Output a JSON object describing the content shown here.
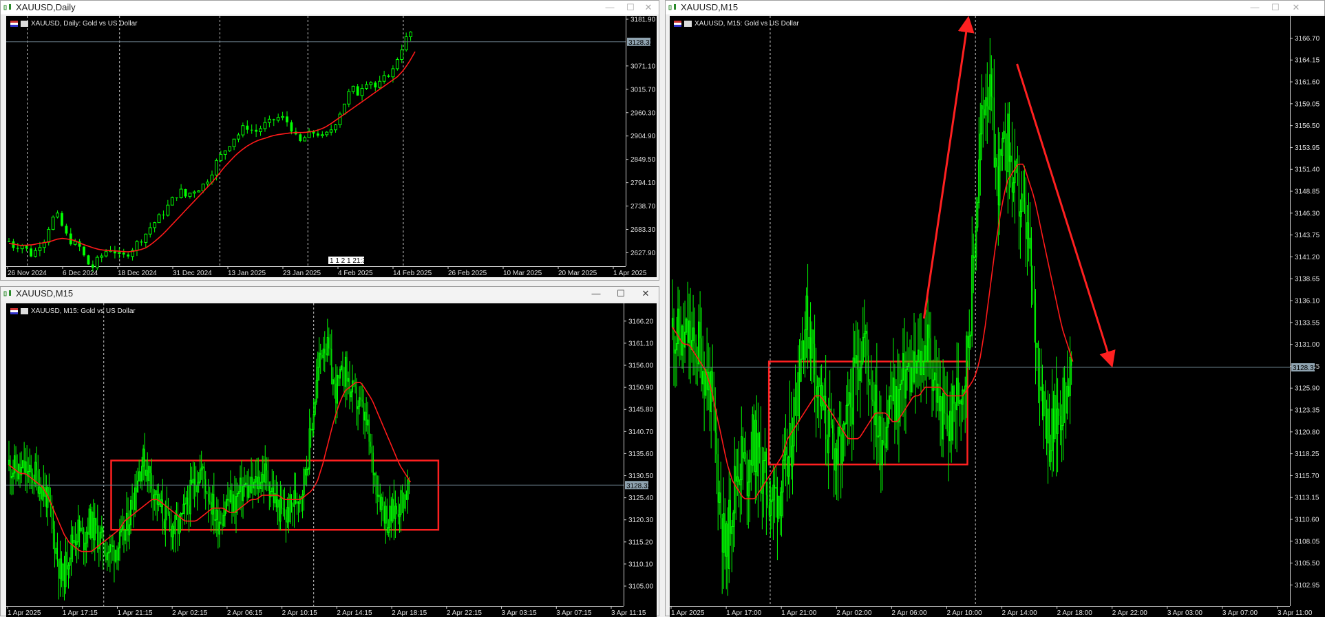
{
  "windows": {
    "daily": {
      "title": "XAUUSD,Daily",
      "legend": "XAUUSD, Daily:  Gold vs US Dollar",
      "controls": {
        "minimize": "—",
        "maximize": "☐",
        "close": "✕"
      }
    },
    "m15_small": {
      "title": "XAUUSD,M15",
      "legend": "XAUUSD, M15:  Gold vs US Dollar",
      "controls": {
        "minimize": "—",
        "maximize": "☐",
        "close": "✕"
      }
    },
    "m15_large": {
      "title": "XAUUSD,M15",
      "legend": "XAUUSD, M15:  Gold vs US Dollar",
      "controls": {
        "minimize": "—",
        "maximize": "☐",
        "close": "✕"
      }
    }
  },
  "colors": {
    "background": "#000000",
    "bull": "#00ff00",
    "bear": "#00ff00",
    "ma": "#ff1a1a",
    "annotation": "#ff2020",
    "grid_vertical": "#c8c8c8",
    "price_line": "#6a7f8c",
    "price_tag": "#8fa3b0"
  },
  "chart_data": [
    {
      "id": "daily",
      "type": "candlestick",
      "title": "XAUUSD, Daily:  Gold vs US Dollar",
      "current_price": "3128.32",
      "y_ticks": [
        "3181.90",
        "3071.10",
        "3015.70",
        "2960.30",
        "2904.90",
        "2849.50",
        "2794.10",
        "2738.70",
        "2683.30",
        "2627.90"
      ],
      "ylim": [
        2596,
        3190
      ],
      "x_ticks": [
        "26 Nov 2024",
        "6 Dec 2024",
        "18 Dec 2024",
        "31 Dec 2024",
        "13 Jan 2025",
        "23 Jan 2025",
        "4 Feb 2025",
        "14 Feb 2025",
        "26 Feb 2025",
        "10 Mar 2025",
        "20 Mar 2025",
        "1 Apr 2025"
      ],
      "period_marker": "1 1 2 1 21:30",
      "close_path": [
        2655,
        2640,
        2650,
        2635,
        2620,
        2645,
        2660,
        2700,
        2720,
        2690,
        2660,
        2650,
        2640,
        2610,
        2590,
        2610,
        2625,
        2640,
        2630,
        2615,
        2625,
        2640,
        2655,
        2670,
        2690,
        2705,
        2720,
        2740,
        2760,
        2775,
        2760,
        2775,
        2780,
        2790,
        2810,
        2840,
        2860,
        2880,
        2900,
        2910,
        2930,
        2920,
        2915,
        2930,
        2935,
        2945,
        2950,
        2940,
        2920,
        2885,
        2900,
        2910,
        2915,
        2900,
        2910,
        2930,
        2960,
        2990,
        3020,
        3005,
        3030,
        3040,
        3020,
        3030,
        3050,
        3060,
        3100,
        3130,
        3150
      ],
      "ma_path": [
        2650,
        2648,
        2645,
        2646,
        2647,
        2650,
        2652,
        2655,
        2660,
        2662,
        2660,
        2657,
        2650,
        2645,
        2640,
        2636,
        2634,
        2633,
        2632,
        2631,
        2630,
        2632,
        2635,
        2640,
        2650,
        2662,
        2675,
        2690,
        2705,
        2720,
        2735,
        2750,
        2765,
        2780,
        2795,
        2812,
        2830,
        2845,
        2860,
        2872,
        2882,
        2890,
        2896,
        2900,
        2905,
        2908,
        2910,
        2912,
        2913,
        2913,
        2914,
        2916,
        2920,
        2926,
        2935,
        2945,
        2955,
        2965,
        2975,
        2985,
        2995,
        3005,
        3015,
        3025,
        3035,
        3045,
        3060,
        3080,
        3105
      ]
    },
    {
      "id": "m15_small",
      "type": "candlestick",
      "title": "XAUUSD, M15:  Gold vs US Dollar",
      "current_price": "3128.32",
      "y_ticks": [
        "3166.20",
        "3161.10",
        "3156.00",
        "3150.90",
        "3145.80",
        "3140.70",
        "3135.60",
        "3130.50",
        "3125.40",
        "3120.30",
        "3115.20",
        "3110.10",
        "3105.00"
      ],
      "ylim": [
        3100.4,
        3170.3
      ],
      "x_ticks": [
        "1 Apr 2025",
        "1 Apr 17:15",
        "1 Apr 21:15",
        "2 Apr 02:15",
        "2 Apr 06:15",
        "2 Apr 10:15",
        "2 Apr 14:15",
        "2 Apr 18:15",
        "2 Apr 22:15",
        "3 Apr 03:15",
        "3 Apr 07:15",
        "3 Apr 11:15"
      ],
      "consolidation_box": {
        "low": 3118,
        "high": 3134
      },
      "close_path": [
        3133,
        3132,
        3131,
        3132,
        3130,
        3131,
        3128,
        3126,
        3120,
        3112,
        3106,
        3112,
        3116,
        3118,
        3116,
        3120,
        3118,
        3116,
        3114,
        3113,
        3114,
        3115,
        3118,
        3124,
        3130,
        3134,
        3132,
        3128,
        3124,
        3121,
        3120,
        3118,
        3119,
        3122,
        3126,
        3130,
        3132,
        3128,
        3124,
        3120,
        3122,
        3125,
        3124,
        3126,
        3128,
        3127,
        3128,
        3130,
        3131,
        3128,
        3124,
        3122,
        3121,
        3124,
        3126,
        3128,
        3135,
        3145,
        3156,
        3162,
        3158,
        3150,
        3152,
        3155,
        3150,
        3148,
        3146,
        3142,
        3134,
        3128,
        3124,
        3120,
        3122,
        3124,
        3126,
        3128
      ],
      "ma_path": [
        3133,
        3132,
        3131,
        3131,
        3130,
        3129,
        3128,
        3126,
        3123,
        3120,
        3117,
        3115,
        3114,
        3113,
        3113,
        3113,
        3114,
        3115,
        3116,
        3117,
        3118,
        3120,
        3121,
        3122,
        3123,
        3124,
        3125,
        3125,
        3124,
        3123,
        3122,
        3121,
        3120,
        3120,
        3120,
        3121,
        3122,
        3123,
        3123,
        3123,
        3122,
        3122,
        3123,
        3124,
        3125,
        3125,
        3126,
        3126,
        3126,
        3126,
        3125,
        3125,
        3125,
        3125,
        3126,
        3127,
        3129,
        3133,
        3138,
        3143,
        3147,
        3150,
        3151,
        3152,
        3152,
        3150,
        3148,
        3145,
        3142,
        3139,
        3136,
        3133,
        3131,
        3129
      ],
      "price_line": 3128.32
    },
    {
      "id": "m15_large",
      "type": "candlestick",
      "title": "XAUUSD, M15:  Gold vs US Dollar",
      "current_price": "3128.32",
      "y_ticks": [
        "3166.70",
        "3164.15",
        "3161.60",
        "3159.05",
        "3156.50",
        "3153.95",
        "3151.40",
        "3148.85",
        "3146.30",
        "3143.75",
        "3141.20",
        "3138.65",
        "3136.10",
        "3133.55",
        "3131.00",
        "3128.45",
        "3125.90",
        "3123.35",
        "3120.80",
        "3118.25",
        "3115.70",
        "3113.15",
        "3110.60",
        "3108.05",
        "3105.50",
        "3102.95"
      ],
      "ylim": [
        3100.5,
        3169.3
      ],
      "x_ticks": [
        "1 Apr 2025",
        "1 Apr 17:00",
        "1 Apr 21:00",
        "2 Apr 02:00",
        "2 Apr 06:00",
        "2 Apr 10:00",
        "2 Apr 14:00",
        "2 Apr 18:00",
        "2 Apr 22:00",
        "3 Apr 03:00",
        "3 Apr 07:00",
        "3 Apr 11:00"
      ],
      "consolidation_box": {
        "low": 3117,
        "high": 3129
      },
      "close_path": [
        3133,
        3132,
        3131,
        3132,
        3130,
        3131,
        3128,
        3126,
        3120,
        3112,
        3106,
        3112,
        3116,
        3118,
        3116,
        3120,
        3118,
        3116,
        3114,
        3113,
        3114,
        3115,
        3118,
        3124,
        3130,
        3134,
        3132,
        3128,
        3124,
        3121,
        3120,
        3118,
        3119,
        3122,
        3126,
        3130,
        3132,
        3128,
        3124,
        3120,
        3122,
        3125,
        3124,
        3126,
        3128,
        3127,
        3128,
        3130,
        3131,
        3128,
        3124,
        3122,
        3121,
        3124,
        3126,
        3128,
        3135,
        3145,
        3156,
        3162,
        3158,
        3150,
        3152,
        3155,
        3150,
        3148,
        3146,
        3142,
        3134,
        3128,
        3124,
        3120,
        3122,
        3124,
        3126,
        3128
      ],
      "ma_path": [
        3133,
        3132,
        3131,
        3131,
        3130,
        3129,
        3128,
        3126,
        3123,
        3120,
        3117,
        3115,
        3114,
        3113,
        3113,
        3113,
        3114,
        3115,
        3116,
        3117,
        3118,
        3120,
        3121,
        3122,
        3123,
        3124,
        3125,
        3125,
        3124,
        3123,
        3122,
        3121,
        3120,
        3120,
        3120,
        3121,
        3122,
        3123,
        3123,
        3123,
        3122,
        3122,
        3123,
        3124,
        3125,
        3125,
        3126,
        3126,
        3126,
        3126,
        3125,
        3125,
        3125,
        3125,
        3126,
        3127,
        3129,
        3133,
        3138,
        3143,
        3147,
        3150,
        3151,
        3152,
        3152,
        3150,
        3148,
        3145,
        3142,
        3139,
        3136,
        3133,
        3131,
        3129
      ],
      "price_line": 3128.32
    }
  ]
}
